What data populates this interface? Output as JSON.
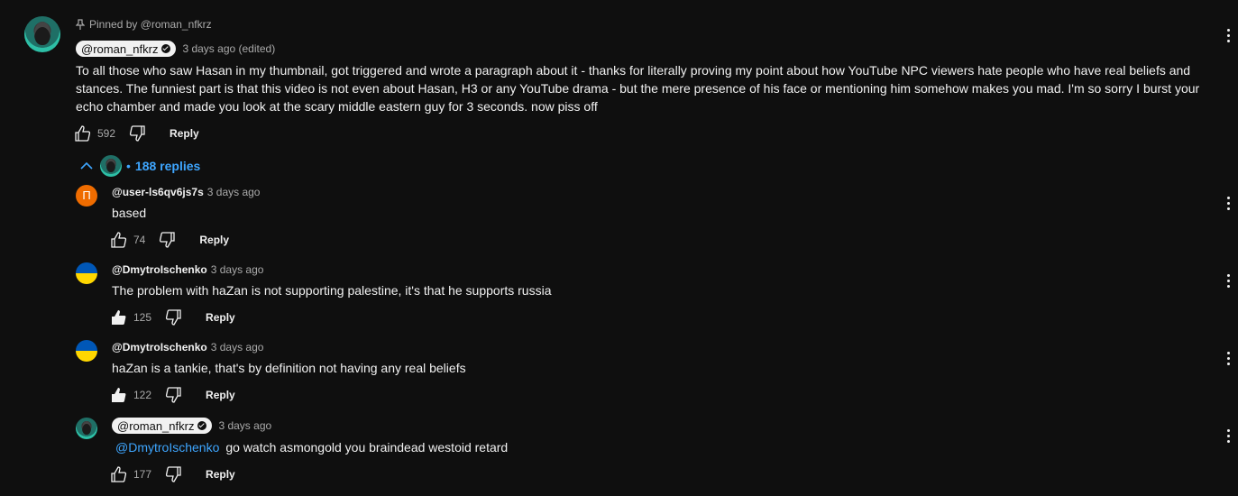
{
  "pinned": {
    "label": "Pinned by @roman_nfkrz"
  },
  "main_comment": {
    "author": "@roman_nfkrz",
    "time": "3 days ago (edited)",
    "text_lines": [
      "To all those who saw Hasan in my thumbnail, got triggered and wrote a paragraph about it - thanks for literally proving my point about how YouTube NPC viewers hate people who have real beliefs and",
      "stances. The funniest part is that this video is not even about Hasan, H3 or any YouTube drama - but the mere presence of his face or mentioning him somehow makes you mad. I'm so sorry I burst your",
      "echo chamber and made you look at the scary middle eastern guy for 3 seconds. now piss off"
    ],
    "likes": "592",
    "reply_label": "Reply"
  },
  "replies_toggle": {
    "separator": "•",
    "label": "188 replies"
  },
  "replies": [
    {
      "avatar_letter": "П",
      "author": "@user-ls6qv6js7s",
      "time": "3 days ago",
      "text": "based",
      "likes": "74",
      "reply_label": "Reply"
    },
    {
      "author": "@DmytroIschenko",
      "time": "3 days ago",
      "text": "The problem with haZan is not supporting palestine, it's that he supports russia",
      "likes": "125",
      "reply_label": "Reply"
    },
    {
      "author": "@DmytroIschenko",
      "time": "3 days ago",
      "text": "haZan is a tankie, that's by definition not having any real beliefs",
      "likes": "122",
      "reply_label": "Reply"
    },
    {
      "author": "@roman_nfkrz",
      "time": "3 days ago",
      "mention": "@DmytroIschenko",
      "text": "go watch asmongold you braindead westoid retard",
      "likes": "177",
      "reply_label": "Reply"
    }
  ],
  "colors": {
    "background": "#0f0f0f",
    "text": "#f1f1f1",
    "muted": "#aaaaaa",
    "link": "#3ea6ff",
    "avatar_orange": "#ef6c00"
  },
  "icons": [
    "pin-icon",
    "verified-check-icon",
    "thumbs-up-icon",
    "thumbs-down-icon",
    "chevron-up-icon",
    "more-vertical-icon"
  ]
}
